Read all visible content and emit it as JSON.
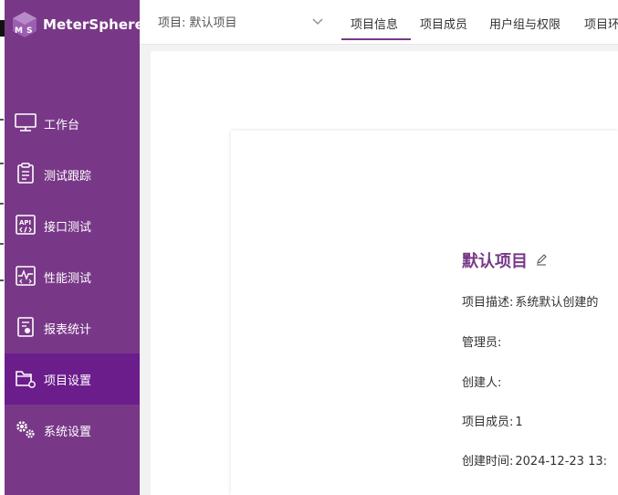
{
  "app": {
    "name": "MeterSphere",
    "accent": "#783887",
    "sidebar_bg": "#783887",
    "sidebar_active_bg": "#6c1d8c"
  },
  "sidebar": {
    "items": [
      {
        "label": "工作台",
        "icon": "monitor-icon"
      },
      {
        "label": "测试跟踪",
        "icon": "clipboard-icon"
      },
      {
        "label": "接口测试",
        "icon": "api-icon"
      },
      {
        "label": "性能测试",
        "icon": "performance-chart-icon"
      },
      {
        "label": "报表统计",
        "icon": "report-icon"
      },
      {
        "label": "项目设置",
        "icon": "folder-settings-icon",
        "active": true
      },
      {
        "label": "系统设置",
        "icon": "gears-icon"
      }
    ]
  },
  "header": {
    "project_select": "项目: 默认项目",
    "tabs": [
      {
        "label": "项目信息",
        "active": true
      },
      {
        "label": "项目成员"
      },
      {
        "label": "用户组与权限"
      },
      {
        "label": "项目环"
      }
    ]
  },
  "project": {
    "title": "默认项目",
    "rows": [
      {
        "label": "项目描述:",
        "value": "系统默认创建的"
      },
      {
        "label": "管理员:",
        "value": ""
      },
      {
        "label": "创建人:",
        "value": ""
      },
      {
        "label": "项目成员:",
        "value": "1"
      },
      {
        "label": "创建时间:",
        "value": "2024-12-23 13:"
      }
    ]
  }
}
